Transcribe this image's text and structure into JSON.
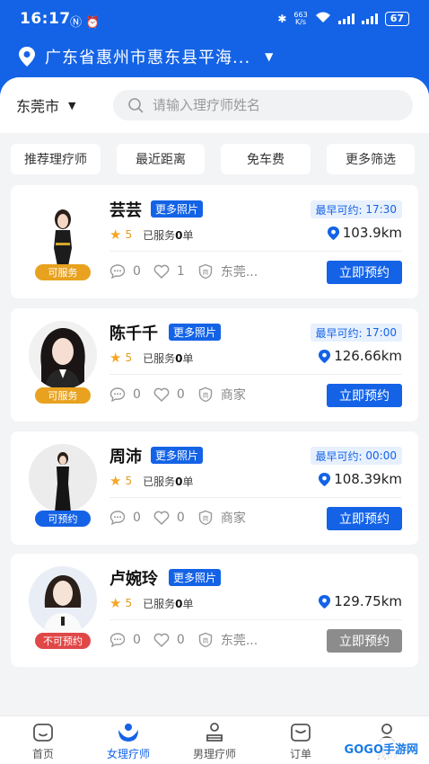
{
  "status_bar": {
    "time": "16:17",
    "net_speed_value": "663",
    "net_speed_unit": "K/s",
    "battery": "67"
  },
  "location": {
    "text": "广东省惠州市惠东县平海..."
  },
  "search": {
    "city": "东莞市",
    "placeholder": "请输入理疗师姓名"
  },
  "filters": [
    {
      "label": "推荐理疗师"
    },
    {
      "label": "最近距离"
    },
    {
      "label": "免车费"
    },
    {
      "label": "更多筛选"
    }
  ],
  "therapists": [
    {
      "name": "芸芸",
      "more_photos": "更多照片",
      "earliest_label": "最早可约:",
      "earliest_time": "17:30",
      "rating": "5",
      "served_prefix": "已服务",
      "served_count": "0",
      "served_suffix": "单",
      "distance": "103.9km",
      "comments": "0",
      "likes": "1",
      "merchant": "东莞...",
      "status": "可服务",
      "status_color": "#e8a21f",
      "book_label": "立即预约",
      "book_color": "#1463e6"
    },
    {
      "name": "陈千千",
      "more_photos": "更多照片",
      "earliest_label": "最早可约:",
      "earliest_time": "17:00",
      "rating": "5",
      "served_prefix": "已服务",
      "served_count": "0",
      "served_suffix": "单",
      "distance": "126.66km",
      "comments": "0",
      "likes": "0",
      "merchant": "商家",
      "status": "可服务",
      "status_color": "#e8a21f",
      "book_label": "立即预约",
      "book_color": "#1463e6"
    },
    {
      "name": "周沛",
      "more_photos": "更多照片",
      "earliest_label": "最早可约:",
      "earliest_time": "00:00",
      "rating": "5",
      "served_prefix": "已服务",
      "served_count": "0",
      "served_suffix": "单",
      "distance": "108.39km",
      "comments": "0",
      "likes": "0",
      "merchant": "商家",
      "status": "可预约",
      "status_color": "#1463e6",
      "book_label": "立即预约",
      "book_color": "#1463e6"
    },
    {
      "name": "卢婉玲",
      "more_photos": "更多照片",
      "earliest_label": "",
      "earliest_time": "",
      "rating": "5",
      "served_prefix": "已服务",
      "served_count": "0",
      "served_suffix": "单",
      "distance": "129.75km",
      "comments": "0",
      "likes": "0",
      "merchant": "东莞...",
      "status": "不可预约",
      "status_color": "#e04848",
      "book_label": "立即预约",
      "book_color": "#8c8c8c"
    }
  ],
  "tabbar": [
    {
      "label": "首页",
      "icon": "home-icon"
    },
    {
      "label": "女理疗师",
      "icon": "female-therapist-icon"
    },
    {
      "label": "男理疗师",
      "icon": "male-therapist-icon"
    },
    {
      "label": "订单",
      "icon": "order-icon"
    },
    {
      "label": "我的",
      "icon": "profile-icon"
    }
  ],
  "watermark": "GOGO手游网",
  "colors": {
    "brand": "#1463e6",
    "available": "#e8a21f",
    "unavailable": "#e04848",
    "disabled": "#8c8c8c"
  }
}
